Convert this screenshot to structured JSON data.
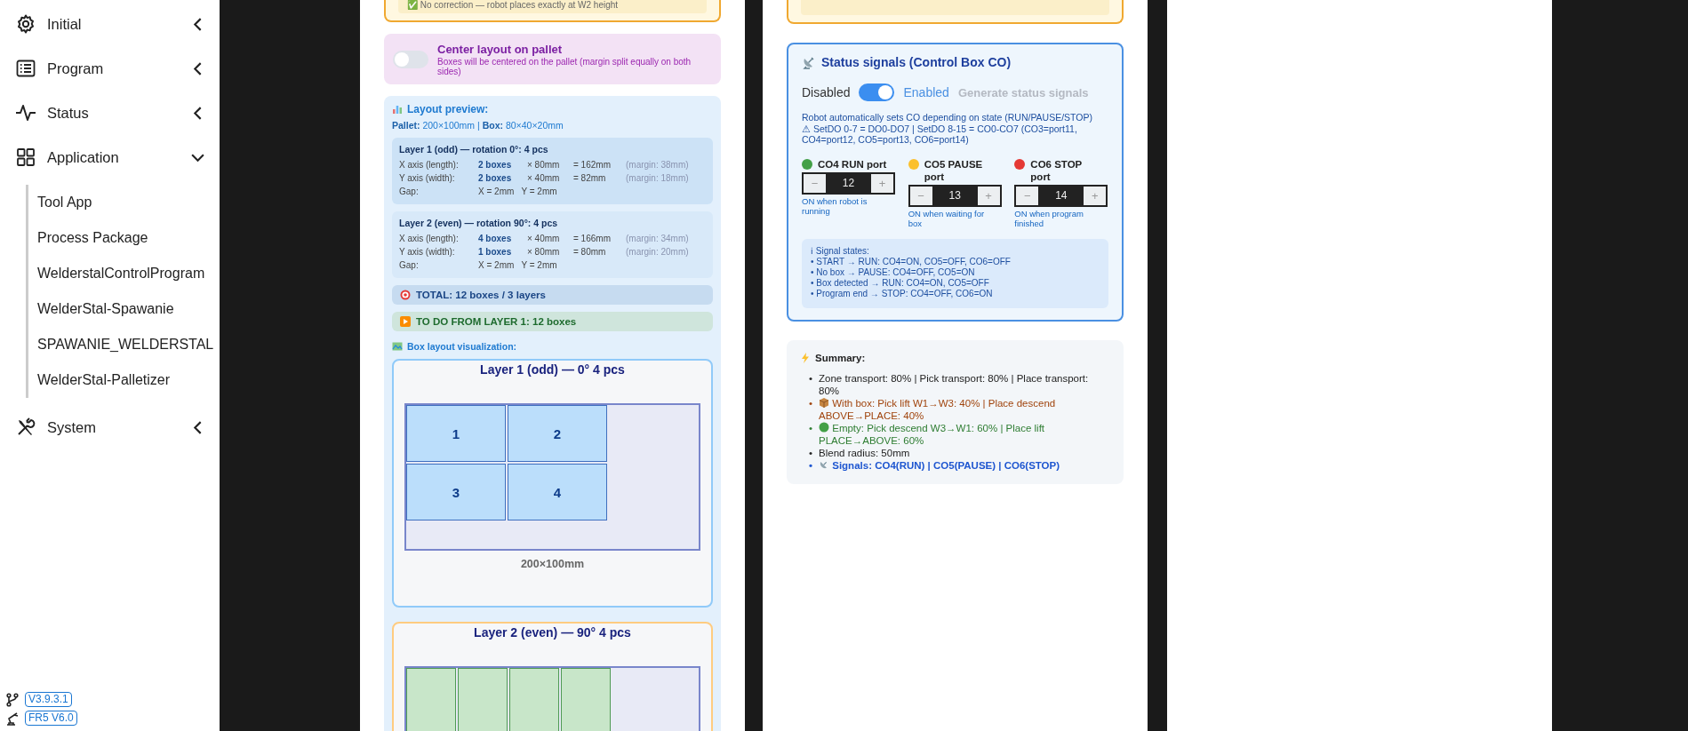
{
  "sidebar": {
    "items": [
      {
        "label": "Initial",
        "kind": "gear",
        "expanded": false
      },
      {
        "label": "Program",
        "kind": "list",
        "expanded": false
      },
      {
        "label": "Status",
        "kind": "pulse",
        "expanded": false
      },
      {
        "label": "Application",
        "kind": "grid",
        "expanded": true,
        "children": [
          {
            "label": "Tool App"
          },
          {
            "label": "Process Package"
          },
          {
            "label": "WelderstalControlProgram"
          },
          {
            "label": "WelderStal-Spawanie"
          },
          {
            "label": "SPAWANIE_WELDERSTAL"
          },
          {
            "label": "WelderStal-Palletizer"
          }
        ]
      },
      {
        "label": "System",
        "kind": "tools",
        "expanded": false
      }
    ],
    "versions": [
      {
        "kind": "branch",
        "label": "V3.9.3.1"
      },
      {
        "kind": "robot",
        "label": "FR5 V6.0"
      }
    ]
  },
  "left_panel": {
    "correction_note": "✅ No correction — robot places exactly at W2 height",
    "center_layout": {
      "on": false,
      "title": "Center layout on pallet",
      "description": "Boxes will be centered on the pallet (margin split equally on both sides)"
    },
    "preview": {
      "title": "Layout preview:",
      "dimensions": "**Pallet:** 200×100mm  |  **Box:** 80×40×20mm",
      "layers": [
        {
          "title": "Layer 1 (odd) — rotation 0°: 4 pcs",
          "rows": [
            {
              "kind": "axis",
              "label": "X axis (length):",
              "count": "2 boxes",
              "size": "× 80mm",
              "total": "= 162mm",
              "margin": "(margin: 38mm)"
            },
            {
              "kind": "axis",
              "label": "Y axis (width):",
              "count": "2 boxes",
              "size": "× 40mm",
              "total": "= 82mm",
              "margin": "(margin: 18mm)"
            },
            {
              "kind": "gap",
              "label": "Gap:",
              "value": "X = 2mm   Y = 2mm"
            }
          ]
        },
        {
          "title": "Layer 2 (even) — rotation 90°: 4 pcs",
          "rows": [
            {
              "kind": "axis",
              "label": "X axis (length):",
              "count": "4 boxes",
              "size": "× 40mm",
              "total": "= 166mm",
              "margin": "(margin: 34mm)"
            },
            {
              "kind": "axis",
              "label": "Y axis (width):",
              "count": "1 boxes",
              "size": "× 80mm",
              "total": "= 80mm",
              "margin": "(margin: 20mm)"
            },
            {
              "kind": "gap",
              "label": "Gap:",
              "value": "X = 2mm   Y = 2mm"
            }
          ]
        }
      ],
      "total": "TOTAL: 12 boxes / 3 layers",
      "todo": "TO DO FROM LAYER 1: 12 boxes",
      "visualization_title": "Box layout visualization:",
      "visualizations": [
        {
          "kind": "odd",
          "title": "Layer 1 (odd) — 0° 4 pcs",
          "boxes": [
            {
              "label": "1"
            },
            {
              "label": "2"
            },
            {
              "label": "3"
            },
            {
              "label": "4"
            }
          ],
          "caption": "200×100mm"
        },
        {
          "kind": "even",
          "title": "Layer 2 (even) — 90° 4 pcs",
          "boxes": [
            {
              "kind": "box"
            },
            {
              "kind": "box"
            },
            {
              "kind": "box"
            },
            {
              "kind": "box"
            }
          ]
        }
      ]
    }
  },
  "middle_panel": {
    "status_signals": {
      "title": "Status signals (Control Box CO)",
      "off_label": "Disabled",
      "on": true,
      "on_label": "Enabled",
      "generate_button": {
        "label": "Generate status signals",
        "disabled": true
      },
      "description": "Robot automatically sets CO depending on state (RUN/PAUSE/STOP)",
      "warning": "⚠ SetDO 0-7 = DO0-DO7 | SetDO 8-15 = CO0-CO7 (CO3=port11, CO4=port12, CO5=port13, CO6=port14)",
      "ports": [
        {
          "label": "CO4 RUN port",
          "color": "#43a047",
          "minus": "−",
          "value": "12",
          "plus": "+",
          "hint": "ON when robot is running"
        },
        {
          "label": "CO5 PAUSE port",
          "color": "#fbc02d",
          "minus": "−",
          "value": "13",
          "plus": "+",
          "hint": "ON when waiting for box"
        },
        {
          "label": "CO6 STOP port",
          "color": "#e53935",
          "minus": "−",
          "value": "14",
          "plus": "+",
          "hint": "ON when program finished"
        }
      ],
      "signal_states": [
        "ℹ Signal states:",
        "• START → RUN: CO4=ON, CO5=OFF, CO6=OFF",
        "• No box → PAUSE: CO4=OFF, CO5=ON",
        "• Box detected → RUN: CO4=ON, CO5=OFF",
        "• Program end → STOP: CO4=OFF, CO6=ON"
      ]
    },
    "summary": {
      "title": "Summary:",
      "items": [
        {
          "kind": "plain",
          "marker": "•",
          "text": "Zone transport: 80% | Pick transport: 80% | Place transport: 80%"
        },
        {
          "kind": "with_box",
          "marker": "•",
          "text": "With box: Pick lift W1→W3: 40% | Place descend ABOVE→PLACE: 40%"
        },
        {
          "kind": "empty",
          "marker": "•",
          "text": "Empty: Pick descend W3→W1: 60% | Place lift PLACE→ABOVE: 60%"
        },
        {
          "kind": "plain",
          "marker": "•",
          "text": "Blend radius: 50mm"
        },
        {
          "kind": "signals",
          "marker": "•",
          "text": "Signals: CO4(RUN) | CO5(PAUSE) | CO6(STOP)"
        }
      ]
    }
  }
}
